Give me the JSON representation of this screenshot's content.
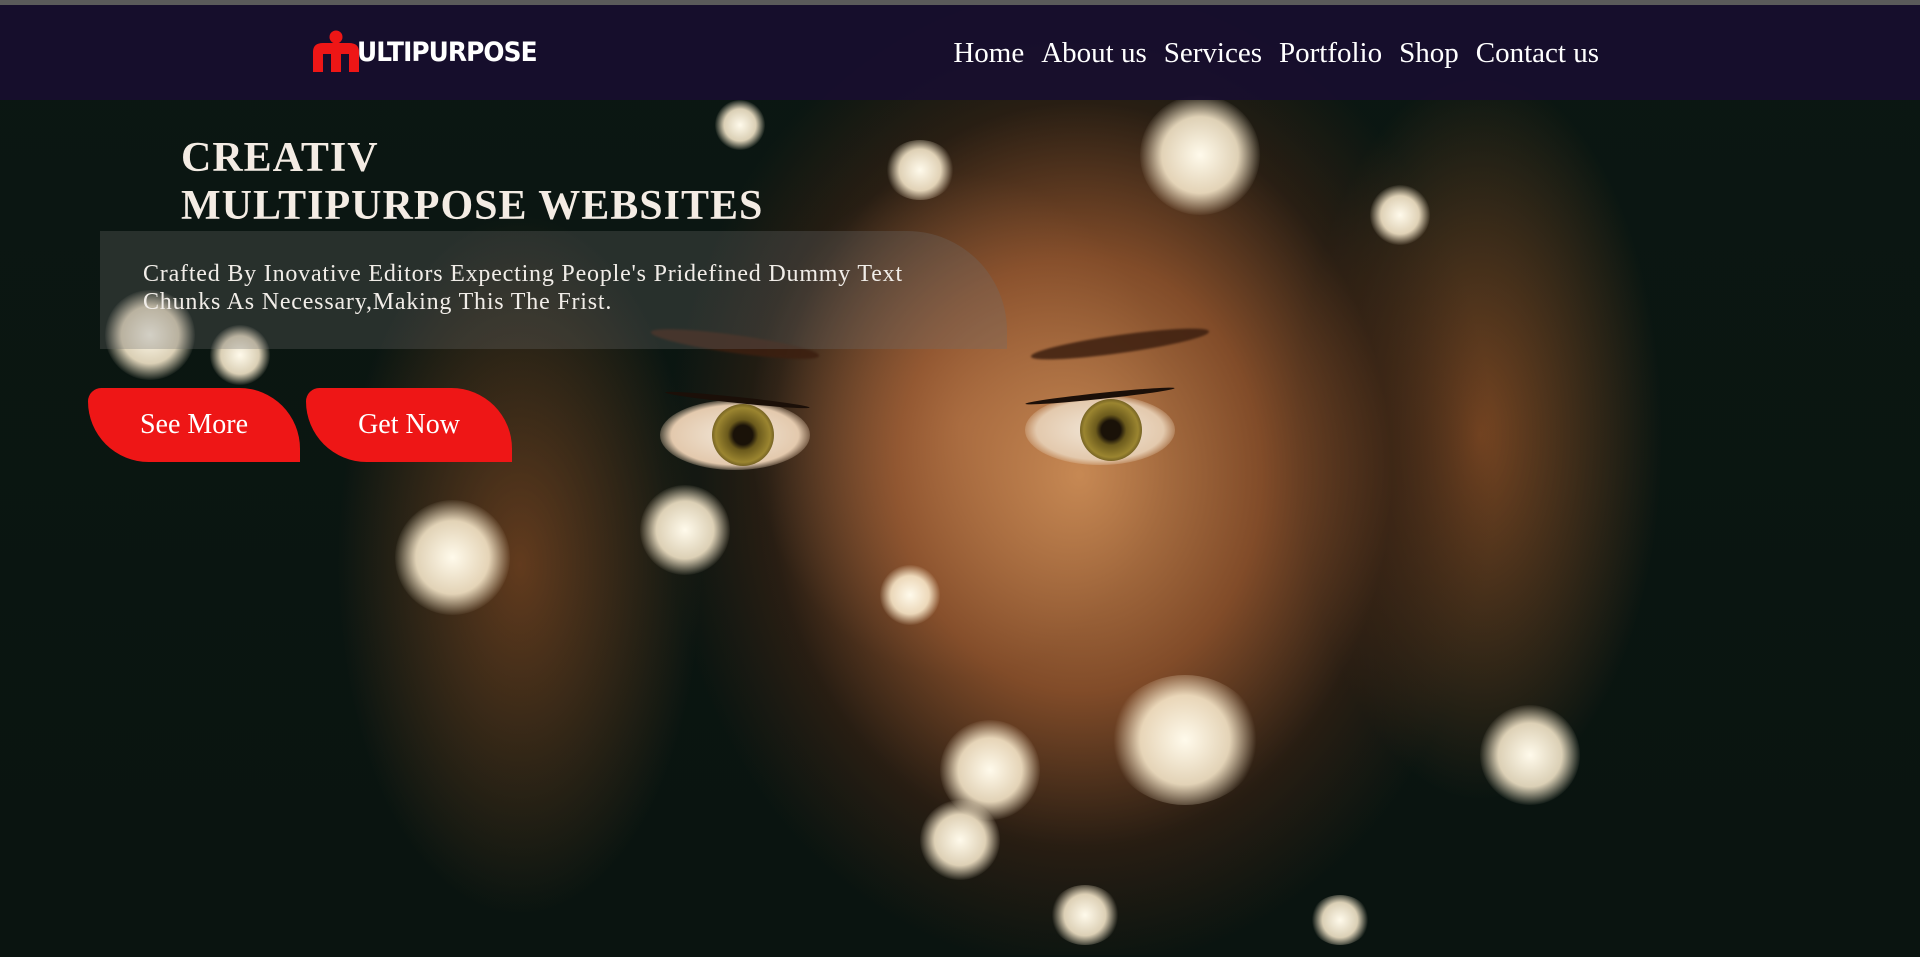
{
  "brand": {
    "logo_text": "ULTIPURPOSE",
    "logo_letter": "M",
    "accent_color": "#ee1616",
    "nav_bg": "#180e2e"
  },
  "nav": {
    "items": [
      "Home",
      "About us",
      "Services",
      "Portfolio",
      "Shop",
      "Contact us"
    ]
  },
  "hero": {
    "headline_line1": "CREATIV",
    "headline_line2": "MULTIPURPOSE WEBSITES",
    "description_line1": "Crafted By Inovative Editors Expecting People's Pridefined Dummy Text",
    "description_line2": "Chunks As Necessary,Making This The Frist.",
    "buttons": {
      "see_more": "See More",
      "get_now": "Get Now"
    },
    "background_image": "woman-face-behind-hands-with-fairy-lights"
  }
}
